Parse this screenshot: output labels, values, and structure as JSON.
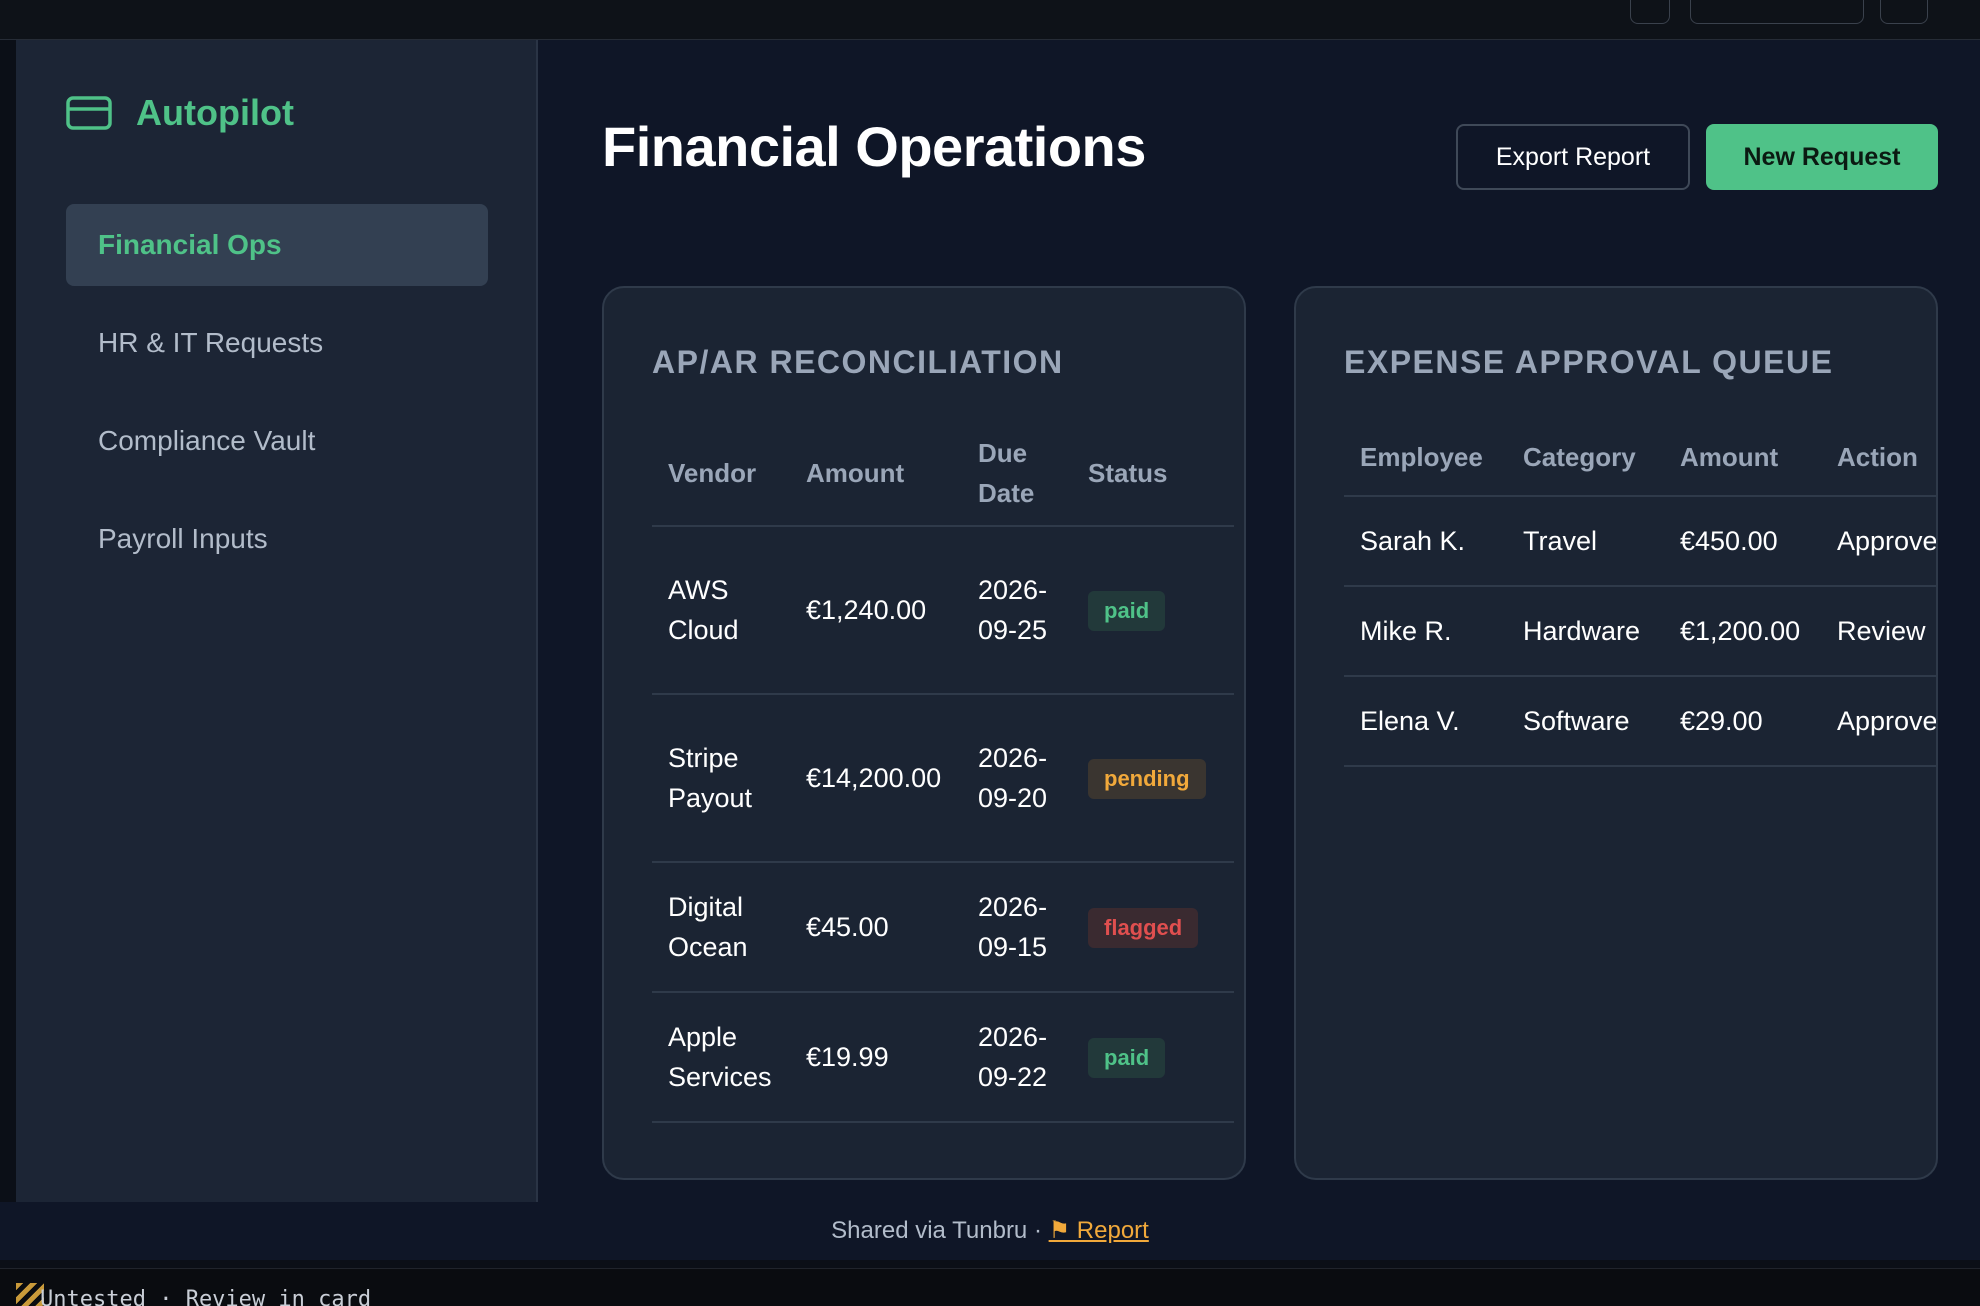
{
  "app": {
    "brand": "Autopilot",
    "accent": "#4fc288"
  },
  "sidebar": {
    "items": [
      {
        "label": "Financial Ops",
        "active": true
      },
      {
        "label": "HR & IT Requests",
        "active": false
      },
      {
        "label": "Compliance Vault",
        "active": false
      },
      {
        "label": "Payroll Inputs",
        "active": false
      }
    ]
  },
  "header": {
    "title": "Financial Operations",
    "export_label": "Export Report",
    "new_label": "New Request"
  },
  "reconciliation": {
    "title": "AP/AR RECONCILIATION",
    "columns": [
      "Vendor",
      "Amount",
      "Due Date",
      "Status"
    ],
    "rows": [
      {
        "vendor": "AWS Cloud",
        "amount": "€1,240.00",
        "due": "2026-09-25",
        "status": "paid"
      },
      {
        "vendor": "Stripe Payout",
        "amount": "€14,200.00",
        "due": "2026-09-20",
        "status": "pending"
      },
      {
        "vendor": "Digital Ocean",
        "amount": "€45.00",
        "due": "2026-09-15",
        "status": "flagged"
      },
      {
        "vendor": "Apple Services",
        "amount": "€19.99",
        "due": "2026-09-22",
        "status": "paid"
      }
    ],
    "status_colors": {
      "paid": {
        "fg": "#4fc288",
        "bg": "#22393a"
      },
      "pending": {
        "fg": "#f1a93b",
        "bg": "#3a3530"
      },
      "flagged": {
        "fg": "#e04f4f",
        "bg": "#3a2a30"
      }
    }
  },
  "expense_queue": {
    "title": "EXPENSE APPROVAL QUEUE",
    "columns": [
      "Employee",
      "Category",
      "Amount",
      "Action"
    ],
    "rows": [
      {
        "employee": "Sarah K.",
        "category": "Travel",
        "amount": "€450.00",
        "action": "Approve"
      },
      {
        "employee": "Mike R.",
        "category": "Hardware",
        "amount": "€1,200.00",
        "action": "Review"
      },
      {
        "employee": "Elena V.",
        "category": "Software",
        "amount": "€29.00",
        "action": "Approve"
      }
    ]
  },
  "footer": {
    "text": "Shared via Tunbru · ",
    "report_label": "⚑ Report"
  },
  "statusbar": {
    "text": "Untested · Review in card"
  }
}
